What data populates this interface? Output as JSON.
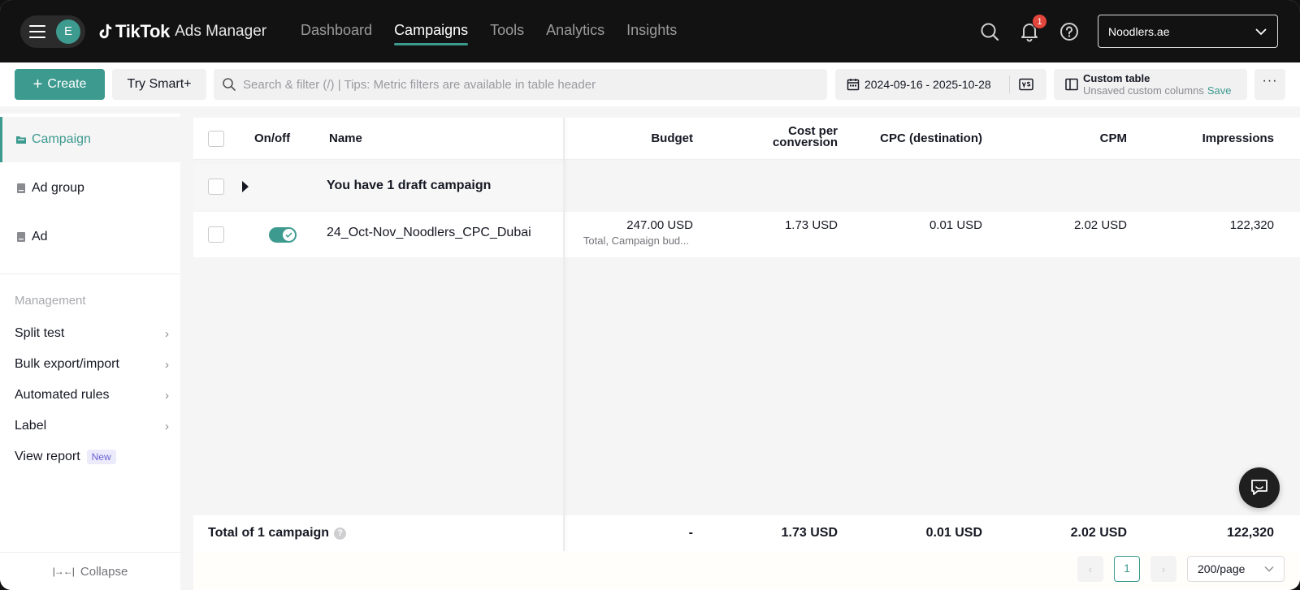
{
  "topbar": {
    "avatar_initial": "E",
    "brand": "TikTok",
    "product": "Ads Manager",
    "nav": [
      {
        "label": "Dashboard",
        "active": false
      },
      {
        "label": "Campaigns",
        "active": true
      },
      {
        "label": "Tools",
        "active": false
      },
      {
        "label": "Analytics",
        "active": false
      },
      {
        "label": "Insights",
        "active": false
      }
    ],
    "notification_count": "1",
    "account_name": "Noodlers.ae",
    "icons": [
      "hamburger-icon",
      "search-icon",
      "bell-icon",
      "help-icon",
      "chevron-down-icon"
    ]
  },
  "toolbar": {
    "create_label": "Create",
    "smart_label": "Try Smart+",
    "search_placeholder": "Search & filter (/) | Tips: Metric filters are available in table header",
    "date_range": "2024-09-16 - 2025-10-28",
    "custom_table_title": "Custom table",
    "custom_table_sub": "Unsaved custom columns",
    "custom_table_save": "Save",
    "more_label": "···"
  },
  "sidebar": {
    "levels": [
      {
        "label": "Campaign",
        "active": true
      },
      {
        "label": "Ad group",
        "active": false
      },
      {
        "label": "Ad",
        "active": false
      }
    ],
    "management_title": "Management",
    "management_items": [
      {
        "label": "Split test"
      },
      {
        "label": "Bulk export/import"
      },
      {
        "label": "Automated rules"
      },
      {
        "label": "Label"
      }
    ],
    "view_report": "View report",
    "new_badge": "New",
    "collapse_label": "Collapse"
  },
  "table": {
    "headers": {
      "onoff": "On/off",
      "name": "Name",
      "budget": "Budget",
      "cost_per_conversion_1": "Cost per",
      "cost_per_conversion_2": "conversion",
      "cpc": "CPC (destination)",
      "cpm": "CPM",
      "impressions": "Impressions"
    },
    "draft_row": "You have 1 draft campaign",
    "rows": [
      {
        "status_on": true,
        "name": "24_Oct-Nov_Noodlers_CPC_Dubai",
        "budget": "247.00 USD",
        "budget_note": "Total, Campaign bud...",
        "cost_per_conversion": "1.73 USD",
        "cpc": "0.01 USD",
        "cpm": "2.02 USD",
        "impressions": "122,320"
      }
    ],
    "total": {
      "label": "Total of 1 campaign",
      "help": "?",
      "budget": "-",
      "cost_per_conversion": "1.73 USD",
      "cpc": "0.01 USD",
      "cpm": "2.02 USD",
      "impressions": "122,320"
    }
  },
  "pagination": {
    "prev": "‹",
    "current_page": "1",
    "next": "›",
    "page_size": "200/page"
  },
  "colors": {
    "accent": "#3c9a8f",
    "topbar": "#121212",
    "badge": "#e2453c"
  }
}
